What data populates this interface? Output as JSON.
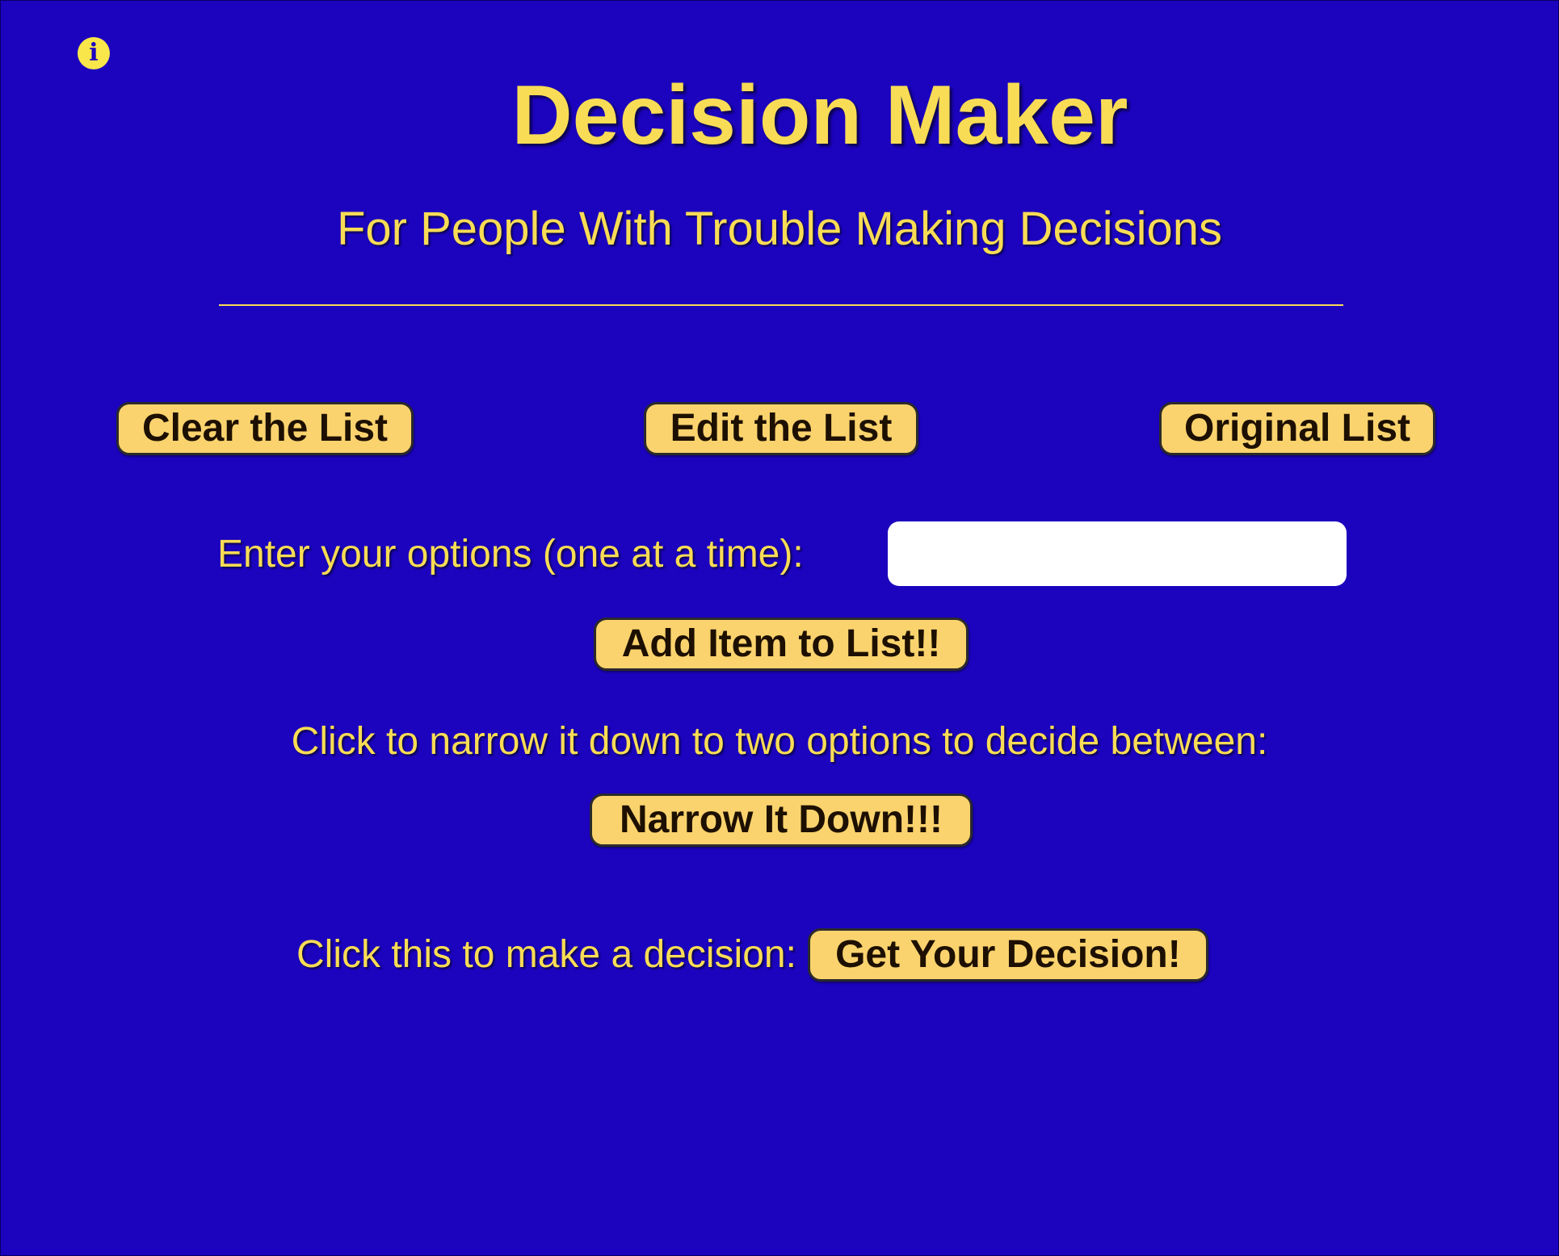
{
  "header": {
    "title": "Decision Maker",
    "subtitle": "For People With Trouble Making Decisions",
    "info_icon": "info-icon"
  },
  "list_controls": {
    "clear_label": "Clear the List",
    "edit_label": "Edit the List",
    "original_label": "Original List"
  },
  "entry": {
    "prompt": "Enter your options (one at a time):",
    "input_value": "",
    "input_placeholder": "",
    "add_label": "Add Item to List!!"
  },
  "narrow": {
    "prompt": "Click to narrow it down to two options to decide between:",
    "button_label": "Narrow It Down!!!"
  },
  "decision": {
    "prompt": "Click this to make a decision:",
    "button_label": "Get Your Decision!"
  },
  "colors": {
    "background": "#1c03be",
    "text": "#f8dc55",
    "button": "#fad36e",
    "button_text": "#1d1000"
  }
}
